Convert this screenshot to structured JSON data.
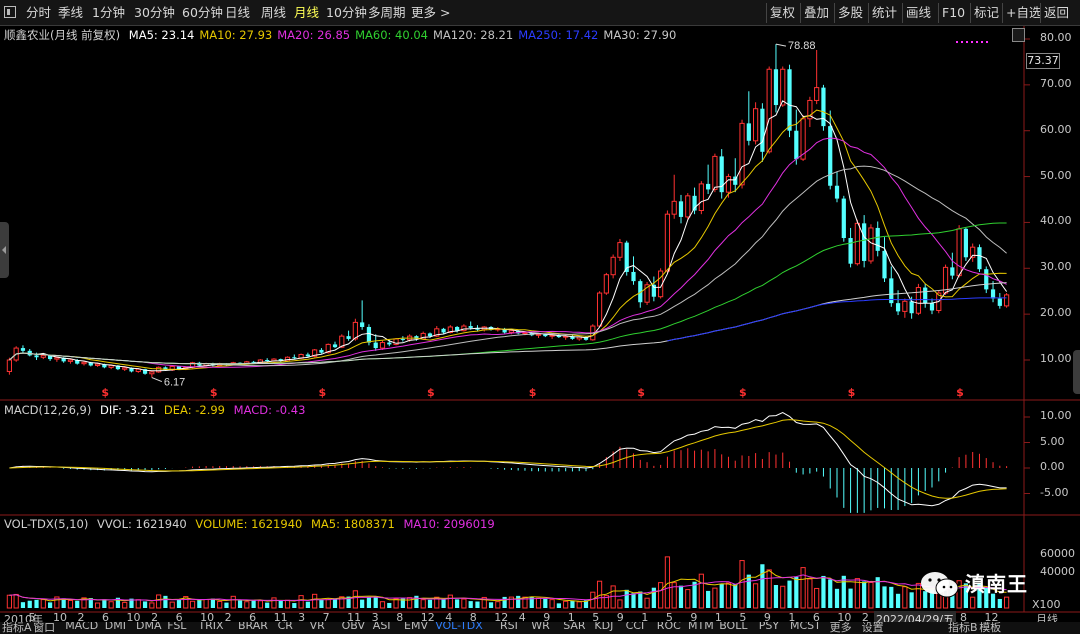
{
  "toolbar": {
    "left": [
      "分时",
      "季线",
      "1分钟",
      "30分钟",
      "60分钟",
      "日线",
      "周线",
      "月线",
      "10分钟",
      "多周期",
      "更多 >"
    ],
    "active": "月线",
    "right": [
      "复权",
      "叠加",
      "多股",
      "统计",
      "画线",
      "F10",
      "标记",
      "+自选",
      "返回"
    ]
  },
  "main": {
    "title": "顺鑫农业(月线 前复权)",
    "ma": [
      {
        "label": "MA5: 23.14",
        "color": "#ffffff"
      },
      {
        "label": "MA10: 27.93",
        "color": "#e6c800"
      },
      {
        "label": "MA20: 26.85",
        "color": "#e030e0"
      },
      {
        "label": "MA60: 40.04",
        "color": "#30d030"
      },
      {
        "label": "MA120: 28.21",
        "color": "#c0c0c0"
      },
      {
        "label": "MA250: 17.42",
        "color": "#2b3cff"
      },
      {
        "label": "MA30: 27.90",
        "color": "#c8c8c8"
      }
    ],
    "price_box": "73.37",
    "high_label": "78.88",
    "low_label": "6.17",
    "y_ticks": [
      "80.00",
      "70.00",
      "60.00",
      "50.00",
      "40.00",
      "30.00",
      "20.00",
      "10.00"
    ]
  },
  "macd": {
    "label": "MACD(12,26,9)",
    "dif": "DIF: -3.21",
    "dea": "DEA: -2.99",
    "macd": "MACD: -0.43",
    "y_ticks": [
      "10.00",
      "5.00",
      "0.00",
      "-5.00"
    ]
  },
  "vol": {
    "label": "VOL-TDX(5,10)",
    "vvol": "VVOL: 1621940",
    "volume": "VOLUME: 1621940",
    "ma5": "MA5: 1808371",
    "ma10": "MA10: 2096019",
    "y_ticks": [
      "60000",
      "40000"
    ],
    "unit": "X100"
  },
  "x_axis": {
    "labels": [
      "2010年",
      "5",
      "10",
      "2",
      "6",
      "10",
      "2",
      "6",
      "10",
      "2",
      "6",
      "11",
      "3",
      "7",
      "11",
      "3",
      "8",
      "12",
      "4",
      "8",
      "12",
      "4",
      "9",
      "1",
      "5",
      "9",
      "1",
      "5",
      "9",
      "1",
      "5",
      "9",
      "1",
      "6",
      "10",
      "2",
      "7",
      "11",
      "4",
      "8",
      "12"
    ],
    "cursor_date": "2022/04/29/五",
    "right_label": "月线"
  },
  "bottom_tabs": [
    "指标A",
    "窗口",
    "MACD",
    "DMI",
    "DMA",
    "FSL",
    "TRIX",
    "BRAR",
    "CR",
    "VR",
    "OBV",
    "ASI",
    "EMV",
    "VOL-TDX",
    "RSI",
    "WR",
    "SAR",
    "KDJ",
    "CCI",
    "ROC",
    "MTM",
    "BOLL",
    "PSY",
    "MCST",
    "更多",
    "设置",
    "指标B",
    "模板"
  ],
  "bottom_active": "VOL-TDX",
  "watermark": "滇南王",
  "colors": {
    "up": "#ff3232",
    "down": "#54ffff",
    "bg": "#000000"
  },
  "chart_data": {
    "type": "candlestick",
    "title": "顺鑫农业(月线 前复权)",
    "ylim": [
      4,
      82
    ],
    "points": [
      [
        7.5,
        10.5,
        6.8,
        10.0
      ],
      [
        10.0,
        13.0,
        9.6,
        12.6
      ],
      [
        12.6,
        13.2,
        11.6,
        12.0
      ],
      [
        12.0,
        12.4,
        10.8,
        11.0
      ],
      [
        11.0,
        11.6,
        10.0,
        10.6
      ],
      [
        10.6,
        11.4,
        10.2,
        11.0
      ],
      [
        11.0,
        11.2,
        9.8,
        10.2
      ],
      [
        10.2,
        10.8,
        9.6,
        10.5
      ],
      [
        10.5,
        10.6,
        9.4,
        9.7
      ],
      [
        9.7,
        10.3,
        9.2,
        10.0
      ],
      [
        10.0,
        10.2,
        9.0,
        9.2
      ],
      [
        9.2,
        9.8,
        8.8,
        9.5
      ],
      [
        9.5,
        9.6,
        8.6,
        8.8
      ],
      [
        8.8,
        9.4,
        8.5,
        9.1
      ],
      [
        9.1,
        9.2,
        8.2,
        8.4
      ],
      [
        8.4,
        9.0,
        8.0,
        8.8
      ],
      [
        8.8,
        8.9,
        7.8,
        8.0
      ],
      [
        8.0,
        8.6,
        7.6,
        8.3
      ],
      [
        8.3,
        8.4,
        7.3,
        7.5
      ],
      [
        7.5,
        8.2,
        7.2,
        8.0
      ],
      [
        8.0,
        8.1,
        6.8,
        7.0
      ],
      [
        7.0,
        7.6,
        6.17,
        7.4
      ],
      [
        7.4,
        8.6,
        7.2,
        8.4
      ],
      [
        8.4,
        8.6,
        7.6,
        7.8
      ],
      [
        7.8,
        8.8,
        7.6,
        8.6
      ],
      [
        8.6,
        8.7,
        7.8,
        8.0
      ],
      [
        8.0,
        8.6,
        7.8,
        8.4
      ],
      [
        8.4,
        9.6,
        8.2,
        9.4
      ],
      [
        9.4,
        9.6,
        8.6,
        8.8
      ],
      [
        8.8,
        9.4,
        8.6,
        9.2
      ],
      [
        9.2,
        9.4,
        8.6,
        8.8
      ],
      [
        8.8,
        9.4,
        8.6,
        9.2
      ],
      [
        9.2,
        9.3,
        8.8,
        9.0
      ],
      [
        9.0,
        9.6,
        8.8,
        9.4
      ],
      [
        9.4,
        9.5,
        8.9,
        9.1
      ],
      [
        9.1,
        9.8,
        9.0,
        9.6
      ],
      [
        9.6,
        9.8,
        9.2,
        9.4
      ],
      [
        9.4,
        10.2,
        9.2,
        10.0
      ],
      [
        10.0,
        10.4,
        9.6,
        9.8
      ],
      [
        9.8,
        10.4,
        9.6,
        10.2
      ],
      [
        10.2,
        10.3,
        9.6,
        9.8
      ],
      [
        9.8,
        10.8,
        9.6,
        10.6
      ],
      [
        10.6,
        11.2,
        10.2,
        10.4
      ],
      [
        10.4,
        11.4,
        10.2,
        11.2
      ],
      [
        11.2,
        11.6,
        10.6,
        10.8
      ],
      [
        10.8,
        12.4,
        10.6,
        12.2
      ],
      [
        12.2,
        12.6,
        11.4,
        11.6
      ],
      [
        11.6,
        13.6,
        11.4,
        13.4
      ],
      [
        13.4,
        14.0,
        12.6,
        12.8
      ],
      [
        12.8,
        15.6,
        12.6,
        15.2
      ],
      [
        15.2,
        16.4,
        14.2,
        14.6
      ],
      [
        14.6,
        19.0,
        14.2,
        18.2
      ],
      [
        18.2,
        23.0,
        16.6,
        17.2
      ],
      [
        17.2,
        17.8,
        13.2,
        13.8
      ],
      [
        13.8,
        15.6,
        12.0,
        12.6
      ],
      [
        12.6,
        14.2,
        12.2,
        13.8
      ],
      [
        13.8,
        14.4,
        13.0,
        13.4
      ],
      [
        13.4,
        14.8,
        13.2,
        14.6
      ],
      [
        14.6,
        15.2,
        14.0,
        14.4
      ],
      [
        14.4,
        15.6,
        14.0,
        15.2
      ],
      [
        15.2,
        15.4,
        14.2,
        14.6
      ],
      [
        14.6,
        16.2,
        14.4,
        15.8
      ],
      [
        15.8,
        16.0,
        14.8,
        15.2
      ],
      [
        15.2,
        17.4,
        15.0,
        16.8
      ],
      [
        16.8,
        17.0,
        15.6,
        16.0
      ],
      [
        16.0,
        17.6,
        15.8,
        17.2
      ],
      [
        17.2,
        17.4,
        16.0,
        16.4
      ],
      [
        16.4,
        17.8,
        16.2,
        17.4
      ],
      [
        17.4,
        18.4,
        16.6,
        17.0
      ],
      [
        17.0,
        17.6,
        16.2,
        16.6
      ],
      [
        16.6,
        17.4,
        16.2,
        17.2
      ],
      [
        17.2,
        17.4,
        16.4,
        16.6
      ],
      [
        16.6,
        17.2,
        16.2,
        16.8
      ],
      [
        16.8,
        17.0,
        15.8,
        16.0
      ],
      [
        16.0,
        16.6,
        15.6,
        16.4
      ],
      [
        16.4,
        16.6,
        15.6,
        15.8
      ],
      [
        15.8,
        16.2,
        15.4,
        16.0
      ],
      [
        16.0,
        16.2,
        15.2,
        15.4
      ],
      [
        15.4,
        15.8,
        14.8,
        15.6
      ],
      [
        15.6,
        15.8,
        15.0,
        15.2
      ],
      [
        15.2,
        15.6,
        14.6,
        15.4
      ],
      [
        15.4,
        15.6,
        14.8,
        15.0
      ],
      [
        15.0,
        15.4,
        14.4,
        15.2
      ],
      [
        15.2,
        15.4,
        14.4,
        14.6
      ],
      [
        14.6,
        15.2,
        14.2,
        15.0
      ],
      [
        15.0,
        15.2,
        14.2,
        14.4
      ],
      [
        14.4,
        17.8,
        14.2,
        17.4
      ],
      [
        17.4,
        25.0,
        17.2,
        24.6
      ],
      [
        24.6,
        29.0,
        24.2,
        28.6
      ],
      [
        28.6,
        33.0,
        27.8,
        32.4
      ],
      [
        32.4,
        36.4,
        31.6,
        35.6
      ],
      [
        35.6,
        36.0,
        28.4,
        29.2
      ],
      [
        29.2,
        32.6,
        26.4,
        27.2
      ],
      [
        27.2,
        27.6,
        21.4,
        22.6
      ],
      [
        22.6,
        27.0,
        22.0,
        26.4
      ],
      [
        26.4,
        28.2,
        22.8,
        23.8
      ],
      [
        23.8,
        30.0,
        23.4,
        29.4
      ],
      [
        29.4,
        42.6,
        29.0,
        41.8
      ],
      [
        41.8,
        50.4,
        40.8,
        44.6
      ],
      [
        44.6,
        46.0,
        39.8,
        41.2
      ],
      [
        41.2,
        46.4,
        40.6,
        45.8
      ],
      [
        45.8,
        47.6,
        41.8,
        42.6
      ],
      [
        42.6,
        49.0,
        41.8,
        48.4
      ],
      [
        48.4,
        52.6,
        46.2,
        47.2
      ],
      [
        47.2,
        55.0,
        46.6,
        54.4
      ],
      [
        54.4,
        56.0,
        45.2,
        46.6
      ],
      [
        46.6,
        50.6,
        45.4,
        50.0
      ],
      [
        50.0,
        54.0,
        46.6,
        48.2
      ],
      [
        48.2,
        62.4,
        47.4,
        61.6
      ],
      [
        61.6,
        68.6,
        56.8,
        57.8
      ],
      [
        57.8,
        66.2,
        57.0,
        64.8
      ],
      [
        64.8,
        66.0,
        53.2,
        55.4
      ],
      [
        55.4,
        74.0,
        55.0,
        73.4
      ],
      [
        73.4,
        78.88,
        64.0,
        65.6
      ],
      [
        65.6,
        74.0,
        65.2,
        73.4
      ],
      [
        73.4,
        74.4,
        58.6,
        60.0
      ],
      [
        60.0,
        64.6,
        52.6,
        53.8
      ],
      [
        53.8,
        63.4,
        53.4,
        62.6
      ],
      [
        62.6,
        67.4,
        60.8,
        66.6
      ],
      [
        66.6,
        77.6,
        65.8,
        69.4
      ],
      [
        69.4,
        70.0,
        60.0,
        61.0
      ],
      [
        61.0,
        64.4,
        47.2,
        48.0
      ],
      [
        48.0,
        51.0,
        44.4,
        45.2
      ],
      [
        45.2,
        45.8,
        35.8,
        36.6
      ],
      [
        36.6,
        38.8,
        30.2,
        31.0
      ],
      [
        31.0,
        40.6,
        30.6,
        39.8
      ],
      [
        39.8,
        41.6,
        30.2,
        31.6
      ],
      [
        31.6,
        39.6,
        31.0,
        38.8
      ],
      [
        38.8,
        40.2,
        32.6,
        33.8
      ],
      [
        33.8,
        36.8,
        27.0,
        27.8
      ],
      [
        27.8,
        30.4,
        21.6,
        22.4
      ],
      [
        22.4,
        25.2,
        19.8,
        20.6
      ],
      [
        20.6,
        23.4,
        19.2,
        22.8
      ],
      [
        22.8,
        23.8,
        19.0,
        20.2
      ],
      [
        20.2,
        26.6,
        19.8,
        25.8
      ],
      [
        25.8,
        26.6,
        21.4,
        22.4
      ],
      [
        22.4,
        23.4,
        20.0,
        20.8
      ],
      [
        20.8,
        25.2,
        20.2,
        24.6
      ],
      [
        24.6,
        30.8,
        24.2,
        30.2
      ],
      [
        30.2,
        33.4,
        27.6,
        28.4
      ],
      [
        28.4,
        39.4,
        28.0,
        38.6
      ],
      [
        38.6,
        38.8,
        31.6,
        32.4
      ],
      [
        32.4,
        35.4,
        31.4,
        34.6
      ],
      [
        34.6,
        35.2,
        29.2,
        29.8
      ],
      [
        29.8,
        30.4,
        24.6,
        25.4
      ],
      [
        25.4,
        27.2,
        22.6,
        23.4
      ],
      [
        23.4,
        24.6,
        21.2,
        21.8
      ],
      [
        21.8,
        24.6,
        21.4,
        24.2
      ]
    ],
    "vol_max": 72000,
    "macd_ylim": [
      -10,
      12
    ]
  }
}
